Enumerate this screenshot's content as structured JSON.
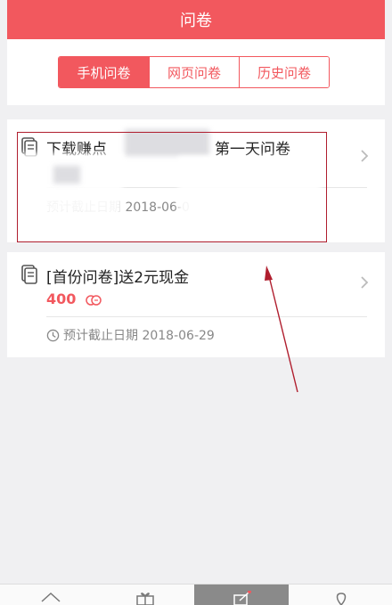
{
  "header": {
    "title": "问卷"
  },
  "tabs": [
    {
      "label": "手机问卷",
      "active": true
    },
    {
      "label": "网页问卷",
      "active": false
    },
    {
      "label": "历史问卷",
      "active": false
    }
  ],
  "surveys": [
    {
      "title_start": "下载赚点",
      "title_end": "第一天问卷",
      "points": "",
      "deadline_label": "预计截止日期 2018-06-0"
    },
    {
      "title": "[首份问卷]送2元现金",
      "points": "400",
      "deadline_label": "预计截止日期 2018-06-29"
    }
  ],
  "colors": {
    "accent": "#f2585e",
    "annotation": "#b01e2e"
  },
  "icons": [
    "document-icon",
    "coin-icon",
    "clock-icon",
    "chevron-right-icon",
    "home-icon",
    "gift-icon",
    "edit-icon",
    "location-icon"
  ]
}
